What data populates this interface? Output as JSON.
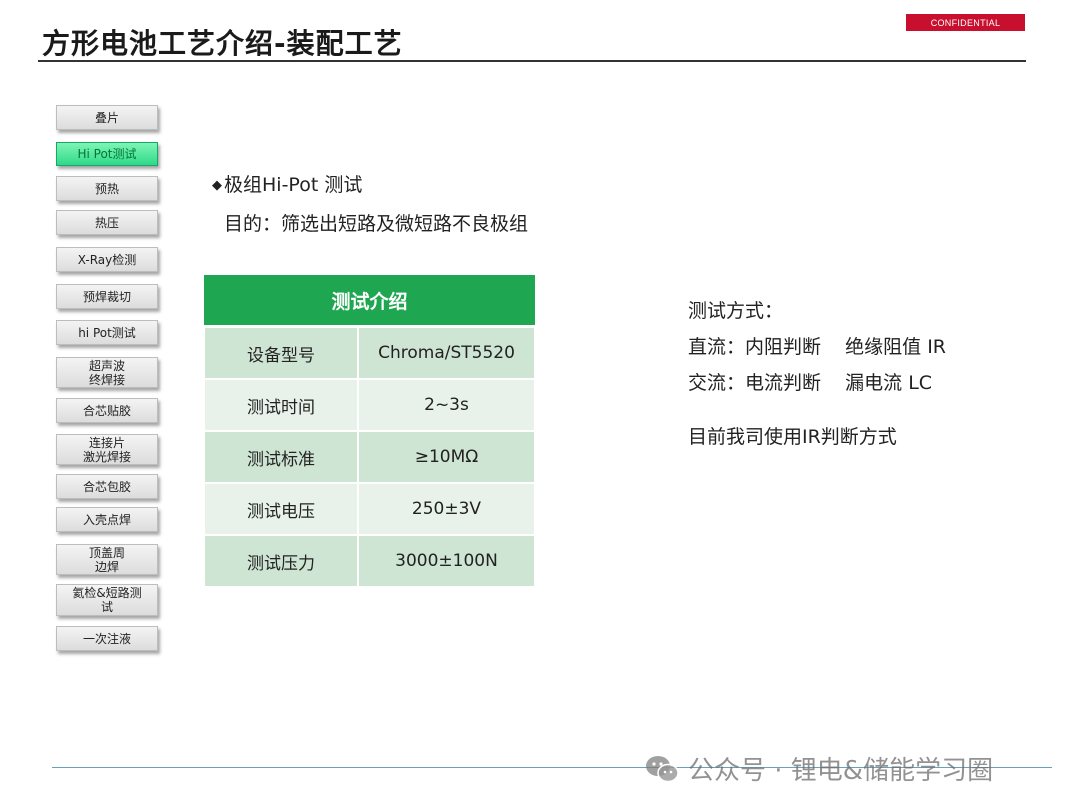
{
  "header": {
    "title": "方形电池工艺介绍-装配工艺",
    "badge": "CONFIDENTIAL",
    "badge_color": "#c8102e"
  },
  "sidebar": {
    "active_color": "#2fd98a",
    "items": [
      {
        "label": "叠片"
      },
      {
        "label": "Hi Pot测试",
        "active": true
      },
      {
        "label": "预热"
      },
      {
        "label": "热压"
      },
      {
        "label": "X-Ray检测"
      },
      {
        "label": "预焊裁切"
      },
      {
        "label": "hi Pot测试"
      },
      {
        "label": "超声波\n终焊接"
      },
      {
        "label": "合芯贴胶"
      },
      {
        "label": "连接片\n激光焊接"
      },
      {
        "label": "合芯包胶"
      },
      {
        "label": "入壳点焊"
      },
      {
        "label": "顶盖周\n边焊"
      },
      {
        "label": "氦检&短路测\n试"
      },
      {
        "label": "一次注液"
      }
    ]
  },
  "main": {
    "heading": "极组Hi-Pot 测试",
    "purpose": "目的：筛选出短路及微短路不良极组",
    "table": {
      "header": "测试介绍",
      "header_color": "#1fa650",
      "rows": [
        [
          "设备型号",
          "Chroma/ST5520"
        ],
        [
          "测试时间",
          "2~3s"
        ],
        [
          "测试标准",
          "≥10MΩ"
        ],
        [
          "测试电压",
          "250±3V"
        ],
        [
          "测试压力",
          "3000±100N"
        ]
      ]
    }
  },
  "right": {
    "method_title": "测试方式：",
    "dc_line": "直流：内阻判断    绝缘阻值 IR",
    "ac_line": "交流：电流判断    漏电流 LC",
    "current": "目前我司使用IR判断方式"
  },
  "watermark": {
    "text": "公众号 · 锂电&储能学习圈",
    "icon": "wechat-icon"
  }
}
